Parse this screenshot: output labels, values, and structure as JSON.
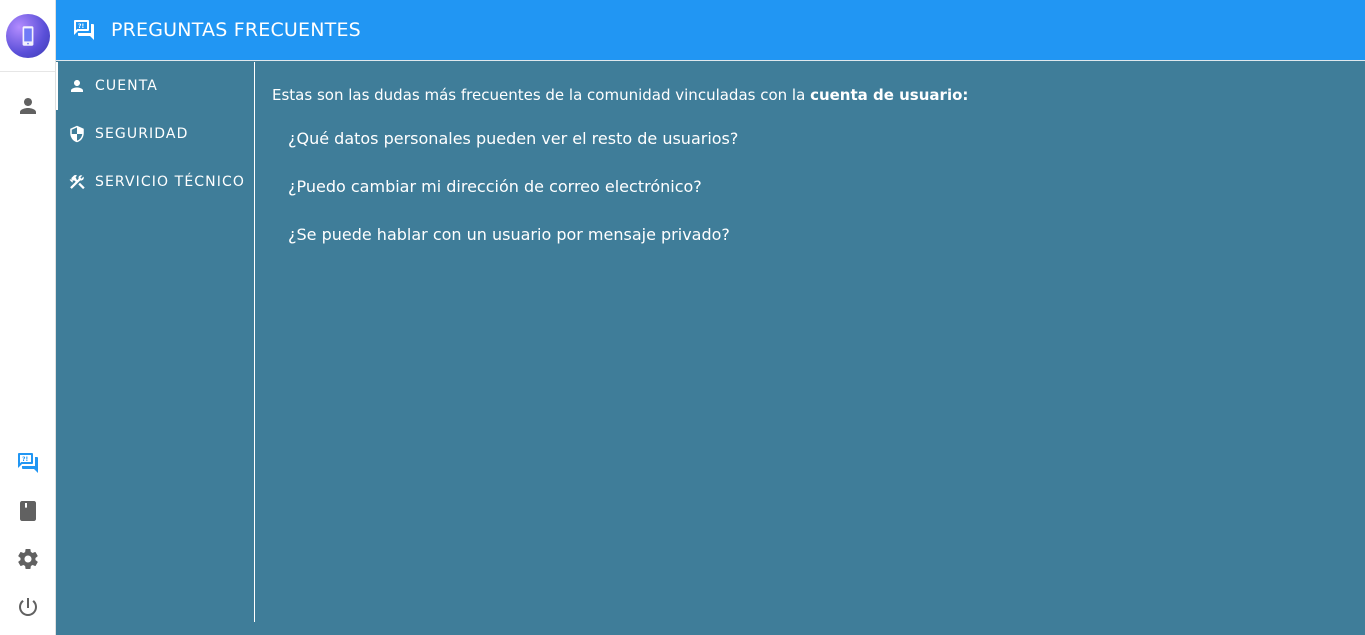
{
  "rail": {
    "logo_icon": "app-logo",
    "items_top": [
      {
        "icon": "person-icon"
      }
    ],
    "items_bottom": [
      {
        "icon": "faq-icon",
        "active": true
      },
      {
        "icon": "book-icon"
      },
      {
        "icon": "gear-icon"
      },
      {
        "icon": "power-icon"
      }
    ]
  },
  "header": {
    "icon": "faq-icon",
    "title": "PREGUNTAS FRECUENTES"
  },
  "categories": [
    {
      "icon": "person-icon",
      "label": "CUENTA",
      "active": true
    },
    {
      "icon": "shield-icon",
      "label": "SEGURIDAD"
    },
    {
      "icon": "tools-icon",
      "label": "SERVICIO TÉCNICO"
    }
  ],
  "main": {
    "intro_prefix": "Estas son las dudas más frecuentes de la comunidad vinculadas con la ",
    "intro_bold": "cuenta de usuario:",
    "questions": [
      "¿Qué datos personales pueden ver el resto de usuarios?",
      "¿Puedo cambiar mi dirección de correo electrónico?",
      "¿Se puede hablar con un usuario por mensaje privado?"
    ]
  },
  "colors": {
    "header_bg": "#2196f3",
    "content_bg": "#3f7d99",
    "rail_bg": "#ffffff",
    "rail_icon": "#616161",
    "rail_active": "#2196f3"
  }
}
